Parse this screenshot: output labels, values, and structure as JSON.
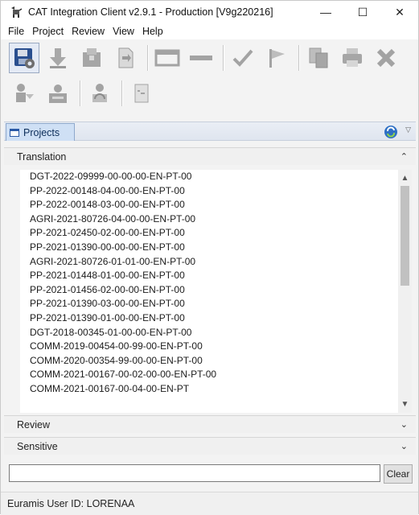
{
  "window": {
    "title": "CAT Integration Client v2.9.1 - Production [V9g220216]",
    "icon": "cat-app-icon",
    "controls": {
      "minimize": "—",
      "maximize": "☐",
      "close": "✕"
    }
  },
  "menu": [
    "File",
    "Project",
    "Review",
    "View",
    "Help"
  ],
  "toolbar": {
    "row1": [
      "save-settings-icon",
      "download-icon",
      "package-icon",
      "document-export-icon",
      "window-icon",
      "dash-icon",
      "checkmark-icon",
      "flag-icon",
      "copy-document-icon",
      "printer-icon",
      "delete-x-icon"
    ],
    "row2": [
      "person-arrow-icon",
      "user-card-icon",
      "user-refresh-icon",
      "document-note-icon"
    ]
  },
  "projects_panel": {
    "tab_label": "Projects",
    "refresh_icon": "refresh-icon",
    "menu_icon": "▽"
  },
  "sections": {
    "translation": {
      "label": "Translation",
      "chevron": "⌃"
    },
    "review": {
      "label": "Review",
      "chevron": "⌄"
    },
    "sensitive": {
      "label": "Sensitive",
      "chevron": "⌄"
    }
  },
  "translation_items": [
    "DGT-2022-09999-00-00-00-EN-PT-00",
    "PP-2022-00148-04-00-00-EN-PT-00",
    "PP-2022-00148-03-00-00-EN-PT-00",
    "AGRI-2021-80726-04-00-00-EN-PT-00",
    "PP-2021-02450-02-00-00-EN-PT-00",
    "PP-2021-01390-00-00-00-EN-PT-00",
    "AGRI-2021-80726-01-01-00-EN-PT-00",
    "PP-2021-01448-01-00-00-EN-PT-00",
    "PP-2021-01456-02-00-00-EN-PT-00",
    "PP-2021-01390-03-00-00-EN-PT-00",
    "PP-2021-01390-01-00-00-EN-PT-00",
    "DGT-2018-00345-01-00-00-EN-PT-00",
    "COMM-2019-00454-00-99-00-EN-PT-00",
    "COMM-2020-00354-99-00-00-EN-PT-00",
    "COMM-2021-00167-00-02-00-00-EN-PT-00",
    "COMM-2021-00167-00-04-00-EN-PT"
  ],
  "filter": {
    "value": "",
    "clear_label": "Clear"
  },
  "status": {
    "text": "Euramis User ID: LORENAA"
  }
}
